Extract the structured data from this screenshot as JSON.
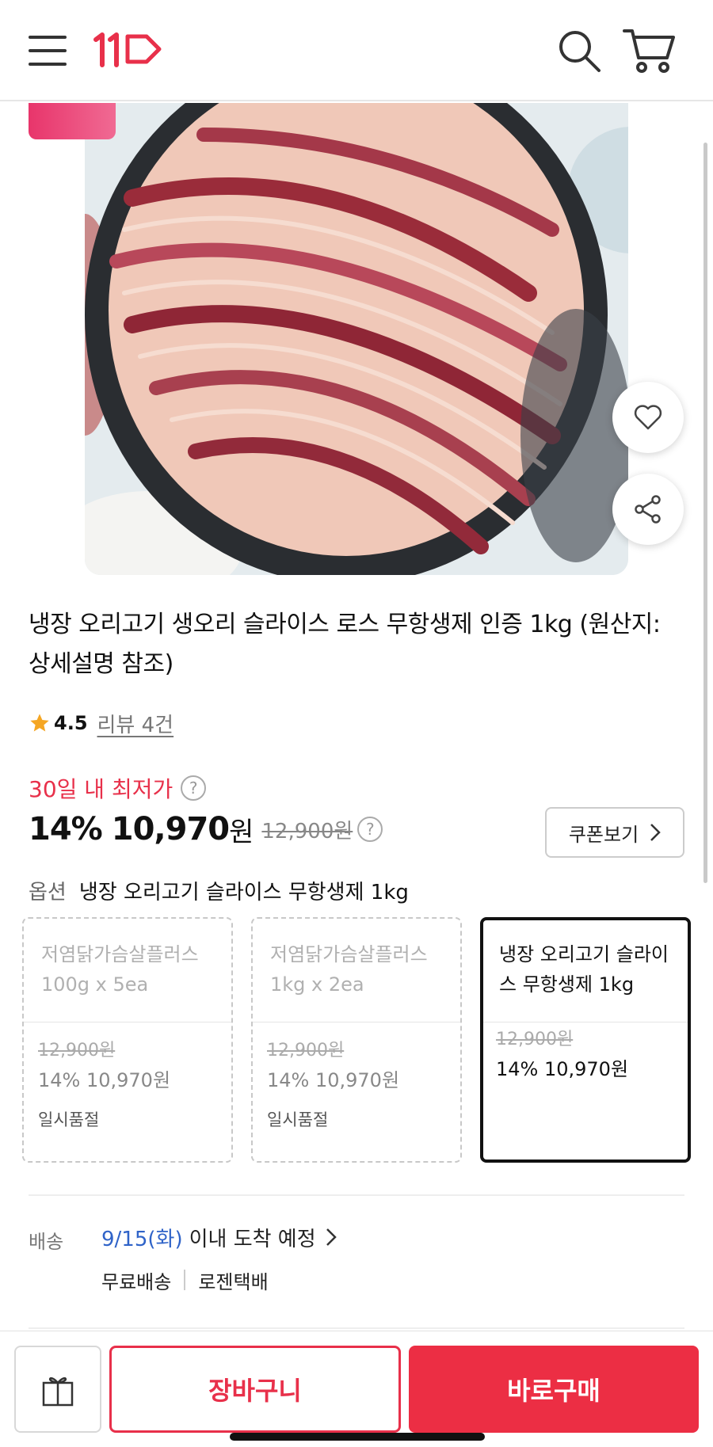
{
  "header": {
    "logo_text": "11ST",
    "icons": [
      "menu-icon",
      "search-icon",
      "cart-icon"
    ]
  },
  "product": {
    "title": "냉장 오리고기 생오리 슬라이스 로스 무항생제 인증 1kg (원산지: 상세설명 참조)",
    "rating": "4.5",
    "review_link": "리뷰 4건",
    "lowest_price_label": "30일 내 최저가",
    "help_glyph": "?",
    "discount": "14%",
    "price": "10,970",
    "currency": "원",
    "original_price": "12,900원",
    "coupon_label": "쿠폰보기",
    "image_icon": "product-photo"
  },
  "options": {
    "label": "옵션",
    "selected_value": "냉장 오리고기 슬라이스 무항생제 1kg",
    "cards": [
      {
        "name": "저염닭가슴살플러스 100g x 5ea",
        "original_price": "12,900원",
        "price": "14% 10,970원",
        "status": "일시품절",
        "selected": false
      },
      {
        "name": "저염닭가슴살플러스 1kg x 2ea",
        "original_price": "12,900원",
        "price": "14% 10,970원",
        "status": "일시품절",
        "selected": false
      },
      {
        "name": "냉장 오리고기 슬라이스 무항생제 1kg",
        "original_price": "12,900원",
        "price": "14% 10,970원",
        "status": "",
        "selected": true
      }
    ]
  },
  "delivery": {
    "label": "배송",
    "date": "9/15(화)",
    "eta_text": "이내 도착 예정",
    "shipping_fee": "무료배송",
    "courier": "로젠택배"
  },
  "bottom_bar": {
    "cart_label": "장바구니",
    "buy_label": "바로구매"
  },
  "colors": {
    "accent": "#e8304a",
    "link_blue": "#2f63c8",
    "star": "#f5a623"
  }
}
